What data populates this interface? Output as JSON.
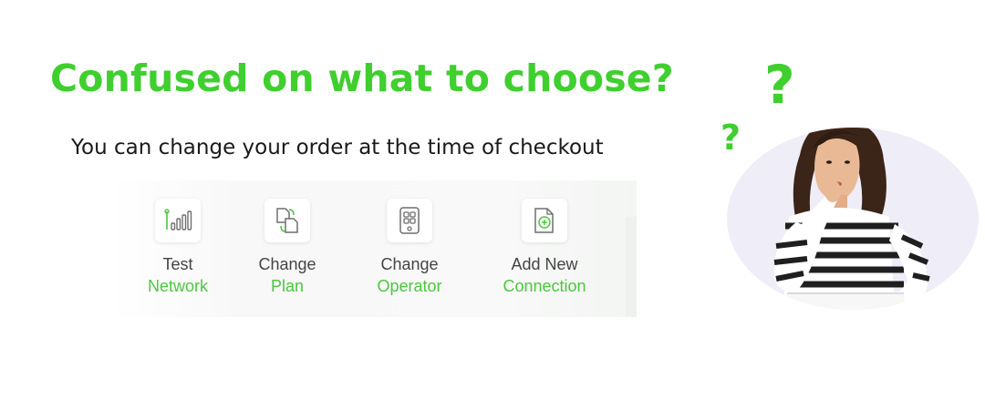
{
  "headline": "Confused on what to choose?",
  "subline": "You can change your order at the time of checkout",
  "colors": {
    "accent": "#3fcf2e",
    "label_green": "#4cc73f",
    "icon_stroke": "#6e6e6e",
    "icon_accent": "#4cc73f"
  },
  "actions": [
    {
      "line1": "Test",
      "line2": "Network",
      "icon": "signal-bars-icon"
    },
    {
      "line1": "Change",
      "line2": "Plan",
      "icon": "swap-documents-icon"
    },
    {
      "line1": "Change",
      "line2": "Operator",
      "icon": "sim-card-icon"
    },
    {
      "line1": "Add New",
      "line2": "Connection",
      "icon": "add-document-icon"
    }
  ],
  "question_marks": [
    "?",
    "?"
  ]
}
